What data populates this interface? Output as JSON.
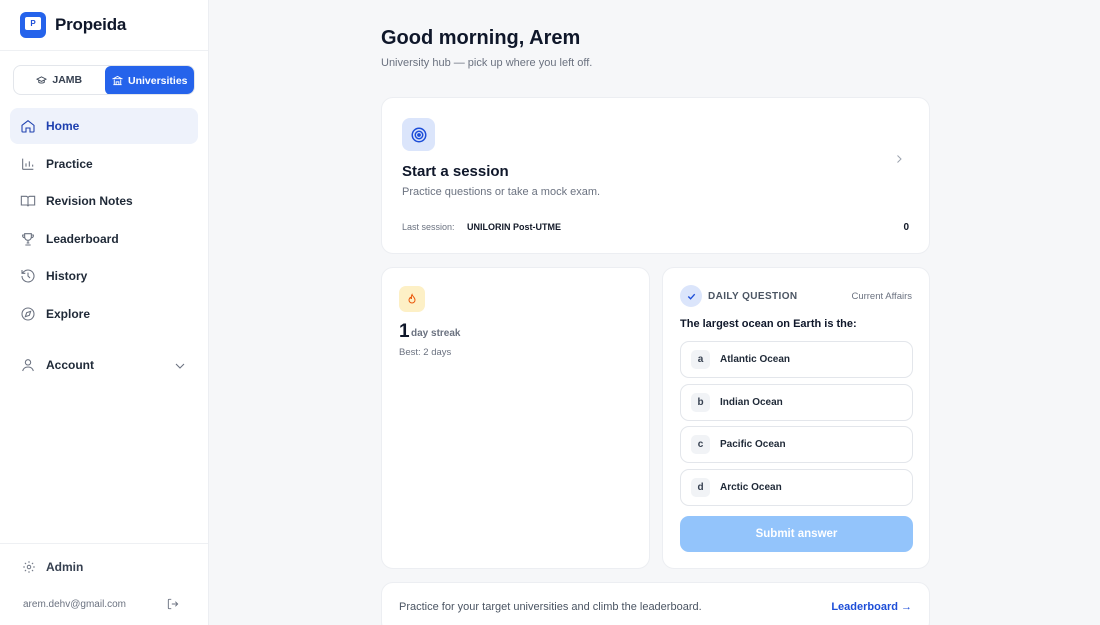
{
  "app": {
    "name": "Propeida",
    "logo_letter": "P",
    "accent": "#2563eb"
  },
  "mode_switch": {
    "options": [
      "JAMB",
      "Universities"
    ],
    "selected": "Universities"
  },
  "sidebar": {
    "items": [
      {
        "label": "Home",
        "icon": "home-icon",
        "active": true
      },
      {
        "label": "Practice",
        "icon": "bar-chart-icon"
      },
      {
        "label": "Revision Notes",
        "icon": "book-icon"
      },
      {
        "label": "Leaderboard",
        "icon": "trophy-icon"
      },
      {
        "label": "History",
        "icon": "history-icon"
      },
      {
        "label": "Explore",
        "icon": "compass-icon"
      }
    ],
    "account": {
      "label": "Account",
      "icon": "user-icon"
    },
    "admin": {
      "label": "Admin",
      "icon": "gear-icon"
    },
    "email": "arem.dehv@gmail.com"
  },
  "header": {
    "greeting": "Good morning, Arem",
    "subtitle": "University hub — pick up where you left off."
  },
  "session": {
    "title": "Start a session",
    "description": "Practice questions or take a mock exam.",
    "last_label": "Last session:",
    "last_value": "UNILORIN Post-UTME",
    "count": "0"
  },
  "streak": {
    "days": "1",
    "unit": "day streak",
    "best": "Best: 2 days"
  },
  "daily_question": {
    "label": "DAILY QUESTION",
    "category": "Current Affairs",
    "question": "The largest ocean on Earth is the:",
    "options": [
      {
        "letter": "a",
        "text": "Atlantic Ocean"
      },
      {
        "letter": "b",
        "text": "Indian Ocean"
      },
      {
        "letter": "c",
        "text": "Pacific Ocean"
      },
      {
        "letter": "d",
        "text": "Arctic Ocean"
      }
    ],
    "submit_label": "Submit answer"
  },
  "footer": {
    "text": "Practice for your target universities and climb the leaderboard.",
    "link_label": "Leaderboard →"
  }
}
